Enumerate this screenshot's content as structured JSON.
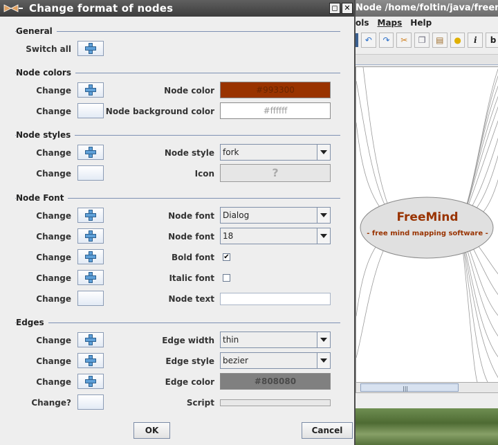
{
  "background_window": {
    "title": "Node /home/foltin/java/freemin",
    "menu": [
      "ols",
      "Maps",
      "Help"
    ],
    "mindmap": {
      "root_title": "FreeMind",
      "root_subtitle": "- free mind mapping software -"
    }
  },
  "dialog": {
    "title": "Change format of nodes",
    "titlebar_buttons": [
      "maximize-icon",
      "close-icon"
    ],
    "sections": {
      "general": "General",
      "node_colors": "Node colors",
      "node_styles": "Node styles",
      "node_font": "Node Font",
      "edges": "Edges"
    },
    "switch_all_label": "Switch all",
    "change_label": "Change",
    "change_q_label": "Change?",
    "fields": {
      "node_color": {
        "label": "Node color",
        "value": "#993300"
      },
      "node_bg_color": {
        "label": "Node background color",
        "value": "#ffffff"
      },
      "node_style": {
        "label": "Node style",
        "value": "fork"
      },
      "icon": {
        "label": "Icon",
        "value": "?"
      },
      "node_font": {
        "label": "Node font",
        "value": "Dialog"
      },
      "node_font_size": {
        "label": "Node font",
        "value": "18"
      },
      "bold_font": {
        "label": "Bold font",
        "checked": true
      },
      "italic_font": {
        "label": "Italic font",
        "checked": false
      },
      "node_text": {
        "label": "Node text",
        "value": ""
      },
      "edge_width": {
        "label": "Edge width",
        "value": "thin"
      },
      "edge_style": {
        "label": "Edge style",
        "value": "bezier"
      },
      "edge_color": {
        "label": "Edge color",
        "value": "#808080"
      },
      "script": {
        "label": "Script",
        "value": ""
      }
    },
    "buttons": {
      "ok": "OK",
      "cancel": "Cancel"
    }
  },
  "colors": {
    "node_color": "#993300",
    "edge_color": "#808080",
    "titlebar": "#4a4a4a",
    "section_line": "#7d90b3"
  }
}
